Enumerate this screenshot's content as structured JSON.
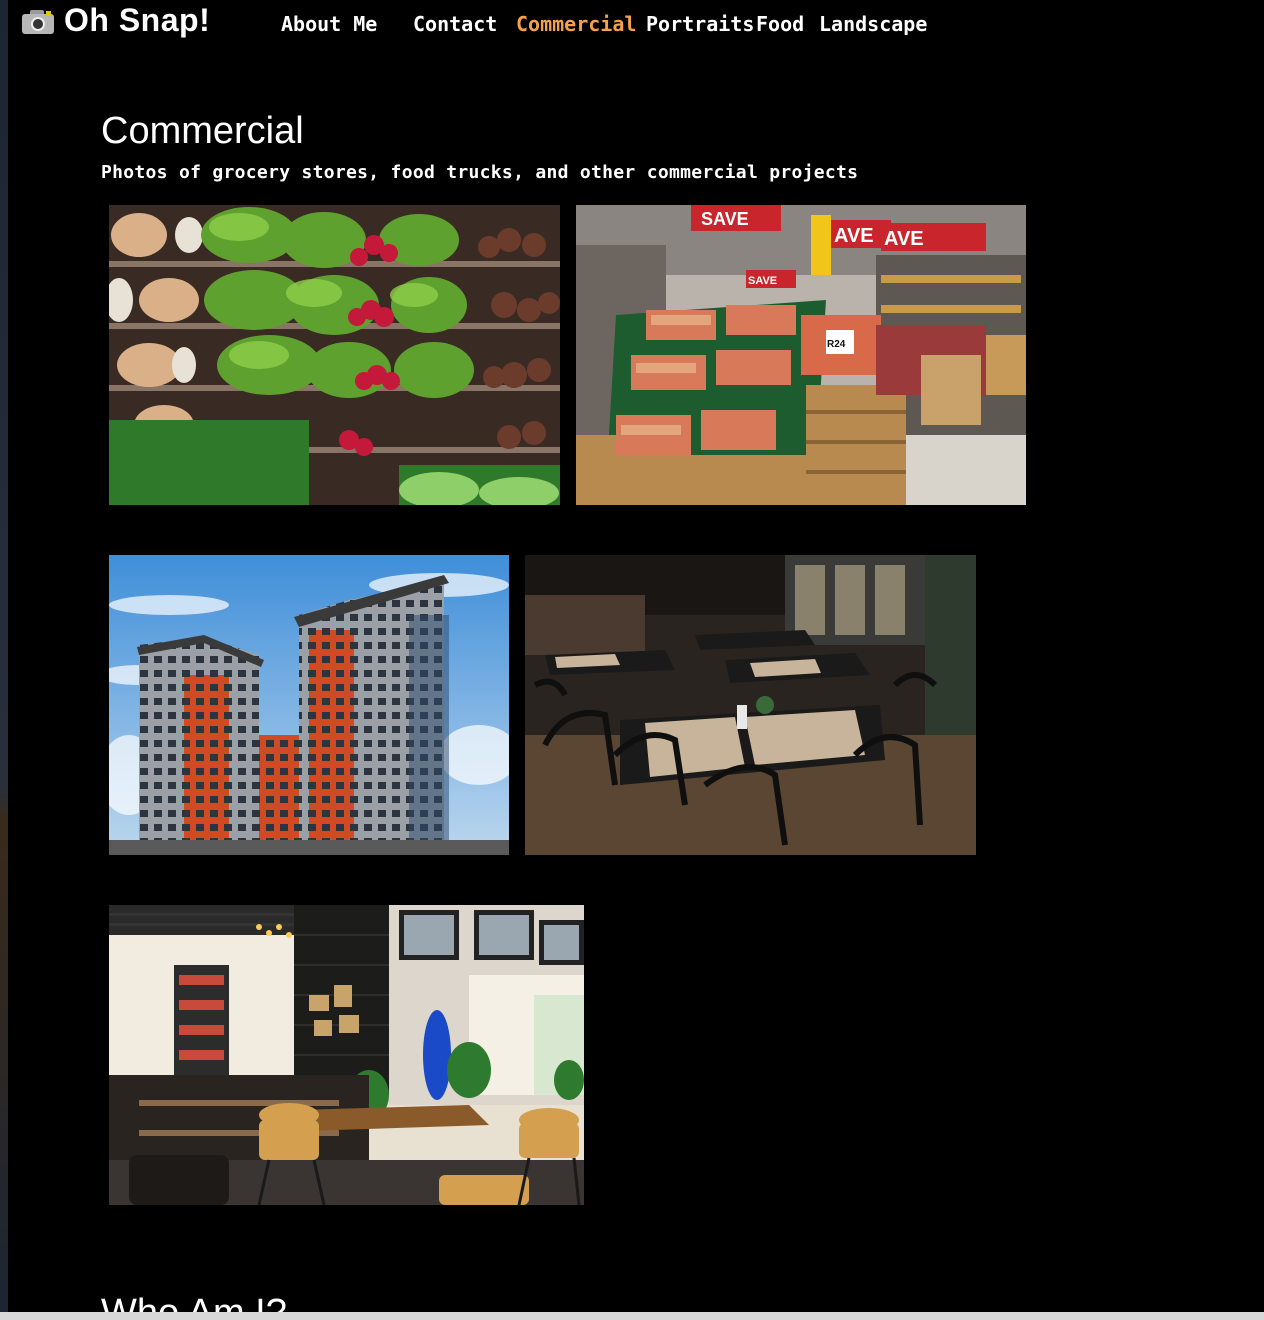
{
  "brand": {
    "name": "Oh Snap!",
    "icon": "camera-icon"
  },
  "nav": {
    "items": [
      {
        "label": "About Me",
        "active": false
      },
      {
        "label": "Contact",
        "active": false
      },
      {
        "label": "Commercial",
        "active": true
      },
      {
        "label": "Portraits",
        "active": false
      },
      {
        "label": "Food",
        "active": false
      },
      {
        "label": "Landscape",
        "active": false
      }
    ],
    "active_color": "#f5a14a"
  },
  "gallery": {
    "title": "Commercial",
    "subtitle": "Photos of grocery stores, food trucks, and other commercial projects",
    "photos": [
      {
        "name": "produce-shelves-photo"
      },
      {
        "name": "supermarket-aisle-photo",
        "signs": [
          "SAVE",
          "AVE",
          "AVE",
          "SAVE",
          "R24"
        ]
      },
      {
        "name": "apartment-buildings-photo"
      },
      {
        "name": "restaurant-tables-photo"
      },
      {
        "name": "cafe-interior-photo"
      }
    ]
  },
  "next_section": {
    "title": "Who Am I?"
  }
}
